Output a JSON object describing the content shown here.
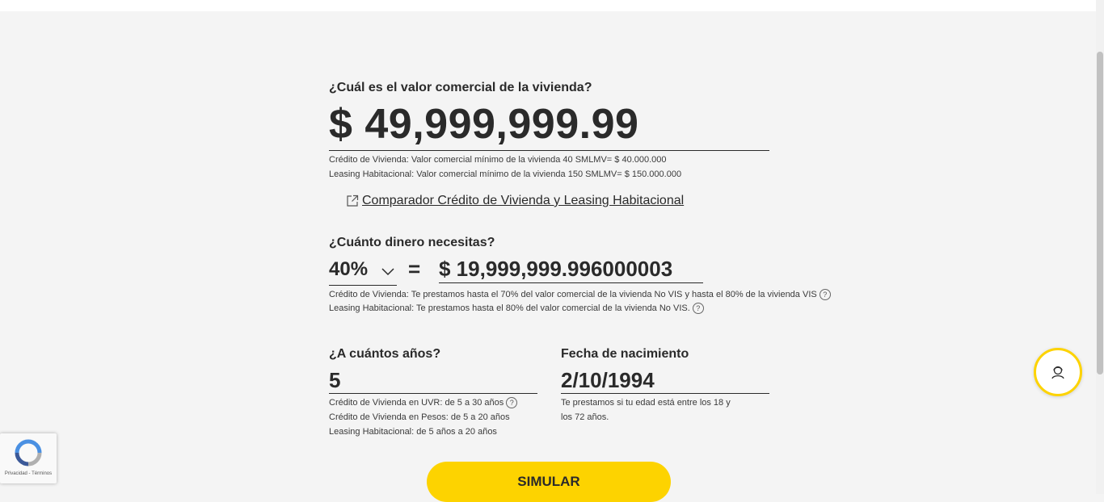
{
  "property": {
    "question": "¿Cuál es el valor comercial de la vivienda?",
    "value": "$ 49,999,999.99",
    "note_credito": "Crédito de Vivienda: Valor comercial mínimo de la vivienda 40 SMLMV= $ 40.000.000",
    "note_leasing": "Leasing Habitacional: Valor comercial mínimo de la vivienda 150 SMLMV= $ 150.000.000"
  },
  "comparator_link": {
    "label": "Comparador Crédito de Vivienda y Leasing Habitacional",
    "icon": "external-link-icon"
  },
  "loan": {
    "question": "¿Cuánto dinero necesitas?",
    "percent": "40%",
    "equals": "=",
    "amount": "$ 19,999,999.996000003",
    "note_credito": "Crédito de Vivienda: Te prestamos hasta el 70% del valor comercial de la vivienda No VIS y hasta el 80% de la vivienda VIS",
    "note_leasing": "Leasing Habitacional: Te prestamos hasta el 80% del valor comercial de la vivienda No VIS."
  },
  "term": {
    "question": "¿A cuántos años?",
    "value": "5",
    "note_uvr": "Crédito de Vivienda en UVR: de 5 a 30 años",
    "note_pesos": "Crédito de Vivienda en Pesos: de 5 a 20 años",
    "note_leasing": "Leasing Habitacional: de 5 años a 20 años"
  },
  "birth": {
    "question": "Fecha de nacimiento",
    "value": "2/10/1994",
    "note_line1": "Te prestamos si tu edad está entre los 18 y",
    "note_line2": "los 72 años."
  },
  "simulate_button": {
    "label": "SIMULAR"
  },
  "help_symbol": "?",
  "recaptcha": {
    "text": "Privacidad - Términos"
  },
  "colors": {
    "accent": "#fdd300",
    "text": "#2a2a2a",
    "background": "#f4f4f4"
  }
}
